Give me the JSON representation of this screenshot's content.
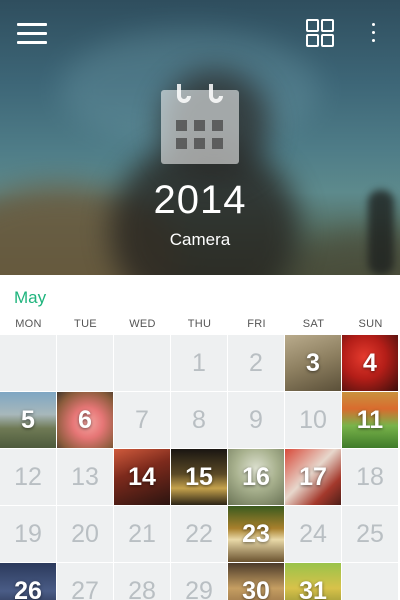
{
  "header": {
    "year": "2014",
    "album": "Camera",
    "icons": {
      "menu": "menu-icon",
      "grid": "grid-view-icon",
      "more": "more-vert-icon",
      "calendar": "calendar-icon"
    }
  },
  "calendar": {
    "month": "May",
    "accent_color": "#1fb47d",
    "weekdays": [
      "MON",
      "TUE",
      "WED",
      "THU",
      "FRI",
      "SAT",
      "SUN"
    ],
    "weeks": [
      [
        "",
        "",
        "",
        "1",
        "2",
        "3",
        "4"
      ],
      [
        "5",
        "6",
        "7",
        "8",
        "9",
        "10",
        "11"
      ],
      [
        "12",
        "13",
        "14",
        "15",
        "16",
        "17",
        "18"
      ],
      [
        "19",
        "20",
        "21",
        "22",
        "23",
        "24",
        "25"
      ],
      [
        "26",
        "27",
        "28",
        "29",
        "30",
        "31",
        ""
      ]
    ],
    "photo_days": {
      "3": "linear-gradient(160deg,#b9ab8c 0%,#8d7f60 50%,#5b5039 100%)",
      "4": "radial-gradient(circle at 40% 40%,#e53b2e 0%,#b41e18 45%,#3c0f0c 100%)",
      "5": "linear-gradient(180deg,#7ea6c3 0%,#a8b8bb 40%,#6f7a55 65%,#4d5a3c 100%)",
      "6": "radial-gradient(circle at 55% 55%,#f6a7a2 0%,#e67676 35%,#8b5c3c 75%,#40362c 100%)",
      "11": "linear-gradient(180deg,#c8923e 0%,#d96b2e 30%,#79b34a 60%,#3f7b2a 100%)",
      "14": "linear-gradient(160deg,#cf5a3c 0%,#7d2a1c 40%,#2b1410 100%)",
      "15": "linear-gradient(180deg,#1a1612 0%,#5b4a26 45%,#c5a24c 70%,#2c2416 100%)",
      "16": "radial-gradient(circle at 50% 35%,#dce0cf 0%,#a9b28f 45%,#6b7456 100%)",
      "17": "linear-gradient(135deg,#d84a3a 0%,#e7d7cc 45%,#a4392c 75%,#4e1e18 100%)",
      "23": "linear-gradient(180deg,#3a5a1e 0%,#a8802c 40%,#e9d9a8 60%,#6b5330 100%)",
      "26": "linear-gradient(180deg,#2b3a5c 0%,#4a5c86 50%,#1a2238 100%)",
      "30": "linear-gradient(180deg,#4b3a2a 0%,#c59e62 45%,#7a5636 100%)",
      "31": "linear-gradient(180deg,#9ac34a 0%,#d8c24a 45%,#6f7b2a 100%)"
    }
  }
}
